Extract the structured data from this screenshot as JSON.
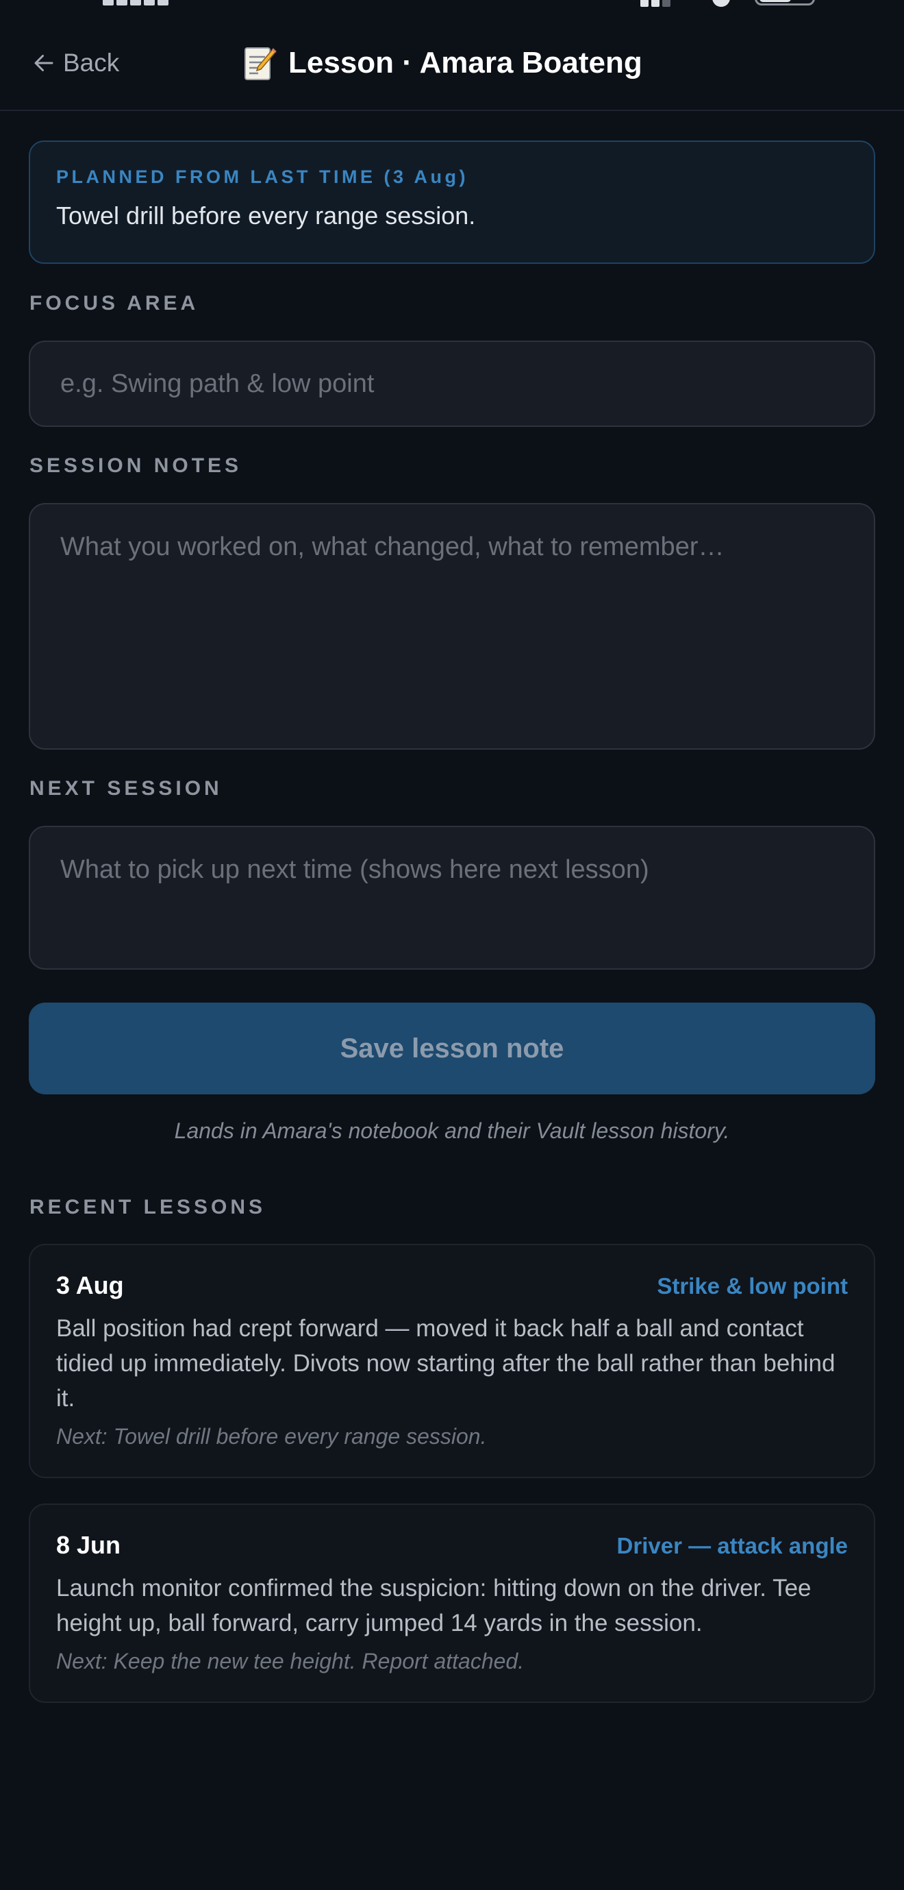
{
  "header": {
    "back_label": "Back",
    "title": "Lesson · Amara Boateng"
  },
  "planned": {
    "label": "PLANNED FROM LAST TIME (3 Aug)",
    "text": "Towel drill before every range session."
  },
  "focus": {
    "label": "FOCUS AREA",
    "placeholder": "e.g. Swing path & low point",
    "value": ""
  },
  "notes": {
    "label": "SESSION NOTES",
    "placeholder": "What you worked on, what changed, what to remember…",
    "value": ""
  },
  "next_session": {
    "label": "NEXT SESSION",
    "placeholder": "What to pick up next time (shows here next lesson)",
    "value": ""
  },
  "save": {
    "label": "Save lesson note",
    "hint": "Lands in Amara's notebook and their Vault lesson history."
  },
  "recent": {
    "label": "RECENT LESSONS",
    "lessons": [
      {
        "date": "3 Aug",
        "tag": "Strike & low point",
        "body": "Ball position had crept forward — moved it back half a ball and contact tidied up immediately. Divots now starting after the ball rather than behind it.",
        "next": "Next: Towel drill before every range session."
      },
      {
        "date": "8 Jun",
        "tag": "Driver — attack angle",
        "body": "Launch monitor confirmed the suspicion: hitting down on the driver. Tee height up, ball forward, carry jumped 14 yards in the session.",
        "next": "Next: Keep the new tee height. Report attached."
      }
    ]
  },
  "icons": {
    "back": "arrow-left-icon",
    "title": "memo-icon"
  },
  "colors": {
    "background": "#0c1017",
    "accent": "#3a86c2",
    "save_button": "#1d4a6e"
  }
}
